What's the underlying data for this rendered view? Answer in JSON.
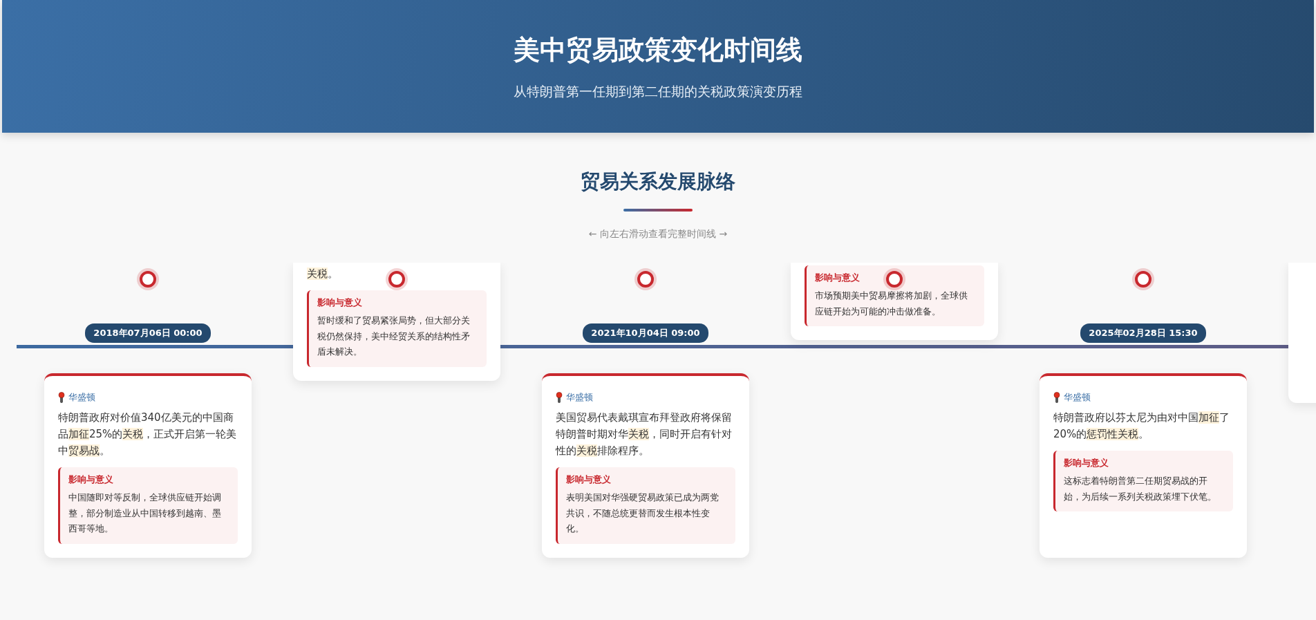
{
  "header": {
    "title": "美中贸易政策变化时间线",
    "subtitle": "从特朗普第一任期到第二任期的关税政策演变历程"
  },
  "section": {
    "title": "贸易关系发展脉络",
    "hint": "← 向左右滑动查看完整时间线 →"
  },
  "items": [
    {
      "kind": "below",
      "date": "2018年07月06日 00:00",
      "location": "华盛顿",
      "description": [
        {
          "text": "特朗普政府对价值340亿美元的中国商品",
          "highlight": false
        },
        {
          "text": "加征",
          "highlight": true
        },
        {
          "text": "25%的",
          "highlight": false
        },
        {
          "text": "关税",
          "highlight": true
        },
        {
          "text": "，正式开启第一轮美中",
          "highlight": false
        },
        {
          "text": "贸易战",
          "highlight": true
        },
        {
          "text": "。",
          "highlight": false
        }
      ],
      "impact_title": "影响与意义",
      "impact": "中国随即对等反制，全球供应链开始调整，部分制造业从中国转移到越南、墨西哥等地。"
    },
    {
      "kind": "above",
      "description": [
        {
          "text": "关税",
          "highlight": true
        },
        {
          "text": "。",
          "highlight": false
        }
      ],
      "impact_title": "影响与意义",
      "impact": "暂时缓和了贸易紧张局势，但大部分关税仍然保持，美中经贸关系的结构性矛盾未解决。"
    },
    {
      "kind": "below",
      "date": "2021年10月04日 09:00",
      "location": "华盛顿",
      "description": [
        {
          "text": "美国贸易代表戴琪宣布拜登政府将保留特朗普时期对华",
          "highlight": false
        },
        {
          "text": "关税",
          "highlight": true
        },
        {
          "text": "，同时开启有针对性的",
          "highlight": false
        },
        {
          "text": "关税",
          "highlight": true
        },
        {
          "text": "排除程序。",
          "highlight": false
        }
      ],
      "impact_title": "影响与意义",
      "impact": "表明美国对华强硬贸易政策已成为两党共识，不随总统更替而发生根本性变化。"
    },
    {
      "kind": "above",
      "impact_title": "影响与意义",
      "impact": "市场预期美中贸易摩擦将加剧，全球供应链开始为可能的冲击做准备。"
    },
    {
      "kind": "below",
      "date": "2025年02月28日 15:30",
      "location": "华盛顿",
      "description": [
        {
          "text": "特朗普政府以芬太尼为由对中国",
          "highlight": false
        },
        {
          "text": "加征",
          "highlight": true
        },
        {
          "text": "了20%的",
          "highlight": false
        },
        {
          "text": "惩罚性",
          "highlight": true
        },
        {
          "text": "关税",
          "highlight": true
        },
        {
          "text": "。",
          "highlight": false
        }
      ],
      "impact_title": "影响与意义",
      "impact": "这标志着特朗普第二任期贸易战的开始，为后续一系列关税政策埋下伏笔。"
    },
    {
      "kind": "above"
    }
  ]
}
